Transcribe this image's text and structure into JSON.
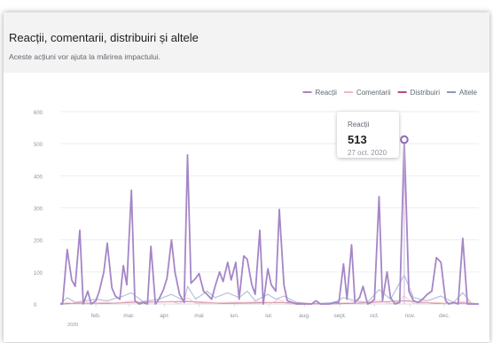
{
  "header": {
    "title": "Reacții, comentarii, distribuiri și altele",
    "subtitle": "Aceste acțiuni vor ajuta la mărirea impactului."
  },
  "tooltip": {
    "label": "Reacții",
    "value": "513",
    "date": "27 oct. 2020"
  },
  "chart_data": {
    "type": "line",
    "ylim": [
      0,
      600
    ],
    "y_ticks": [
      0,
      100,
      200,
      300,
      400,
      500,
      600
    ],
    "y_tick_labels": [
      "0",
      "100",
      "200",
      "300",
      "400",
      "500",
      "600"
    ],
    "x_range": [
      "2020-01-01",
      "2020-12-31"
    ],
    "x_ticks": [
      {
        "date": "2020-02-01",
        "label": "feb."
      },
      {
        "date": "2020-03-01",
        "label": "mar."
      },
      {
        "date": "2020-04-01",
        "label": "apr."
      },
      {
        "date": "2020-05-01",
        "label": "mai"
      },
      {
        "date": "2020-06-01",
        "label": "iun."
      },
      {
        "date": "2020-07-01",
        "label": "iul."
      },
      {
        "date": "2020-08-01",
        "label": "aug."
      },
      {
        "date": "2020-09-01",
        "label": "sept."
      },
      {
        "date": "2020-10-01",
        "label": "oct."
      },
      {
        "date": "2020-11-01",
        "label": "nov."
      },
      {
        "date": "2020-12-01",
        "label": "dec."
      }
    ],
    "x_year_label": "2020",
    "legend": "top-right",
    "grid": true,
    "highlight": {
      "series": "Reacții",
      "date": "2020-10-27",
      "value": 513
    },
    "series": [
      {
        "name": "Reacții",
        "color": "#a586c6",
        "points": [
          [
            "2020-01-01",
            0
          ],
          [
            "2020-01-03",
            0
          ],
          [
            "2020-01-07",
            170
          ],
          [
            "2020-01-11",
            75
          ],
          [
            "2020-01-14",
            55
          ],
          [
            "2020-01-18",
            230
          ],
          [
            "2020-01-21",
            0
          ],
          [
            "2020-01-25",
            40
          ],
          [
            "2020-01-28",
            0
          ],
          [
            "2020-02-01",
            10
          ],
          [
            "2020-02-04",
            40
          ],
          [
            "2020-02-08",
            100
          ],
          [
            "2020-02-11",
            190
          ],
          [
            "2020-02-15",
            50
          ],
          [
            "2020-02-18",
            25
          ],
          [
            "2020-02-22",
            15
          ],
          [
            "2020-02-25",
            120
          ],
          [
            "2020-02-28",
            60
          ],
          [
            "2020-03-03",
            355
          ],
          [
            "2020-03-06",
            10
          ],
          [
            "2020-03-10",
            0
          ],
          [
            "2020-03-13",
            5
          ],
          [
            "2020-03-17",
            0
          ],
          [
            "2020-03-20",
            180
          ],
          [
            "2020-03-24",
            0
          ],
          [
            "2020-03-27",
            15
          ],
          [
            "2020-03-31",
            45
          ],
          [
            "2020-04-03",
            80
          ],
          [
            "2020-04-07",
            200
          ],
          [
            "2020-04-10",
            100
          ],
          [
            "2020-04-14",
            30
          ],
          [
            "2020-04-18",
            5
          ],
          [
            "2020-04-21",
            465
          ],
          [
            "2020-04-24",
            65
          ],
          [
            "2020-04-28",
            80
          ],
          [
            "2020-05-01",
            95
          ],
          [
            "2020-05-05",
            40
          ],
          [
            "2020-05-08",
            30
          ],
          [
            "2020-05-12",
            15
          ],
          [
            "2020-05-15",
            55
          ],
          [
            "2020-05-19",
            100
          ],
          [
            "2020-05-22",
            70
          ],
          [
            "2020-05-26",
            130
          ],
          [
            "2020-05-29",
            75
          ],
          [
            "2020-06-02",
            130
          ],
          [
            "2020-06-05",
            15
          ],
          [
            "2020-06-09",
            150
          ],
          [
            "2020-06-12",
            140
          ],
          [
            "2020-06-16",
            60
          ],
          [
            "2020-06-19",
            30
          ],
          [
            "2020-06-23",
            230
          ],
          [
            "2020-06-26",
            0
          ],
          [
            "2020-06-30",
            110
          ],
          [
            "2020-07-03",
            60
          ],
          [
            "2020-07-07",
            40
          ],
          [
            "2020-07-10",
            295
          ],
          [
            "2020-07-14",
            60
          ],
          [
            "2020-07-17",
            10
          ],
          [
            "2020-07-21",
            5
          ],
          [
            "2020-07-25",
            0
          ],
          [
            "2020-07-29",
            0
          ],
          [
            "2020-08-01",
            0
          ],
          [
            "2020-08-07",
            0
          ],
          [
            "2020-08-11",
            10
          ],
          [
            "2020-08-15",
            0
          ],
          [
            "2020-08-19",
            0
          ],
          [
            "2020-08-23",
            0
          ],
          [
            "2020-08-27",
            5
          ],
          [
            "2020-08-31",
            5
          ],
          [
            "2020-09-04",
            125
          ],
          [
            "2020-09-07",
            15
          ],
          [
            "2020-09-11",
            185
          ],
          [
            "2020-09-14",
            5
          ],
          [
            "2020-09-18",
            20
          ],
          [
            "2020-09-21",
            55
          ],
          [
            "2020-09-25",
            0
          ],
          [
            "2020-09-28",
            5
          ],
          [
            "2020-10-01",
            15
          ],
          [
            "2020-10-05",
            335
          ],
          [
            "2020-10-08",
            10
          ],
          [
            "2020-10-12",
            100
          ],
          [
            "2020-10-15",
            20
          ],
          [
            "2020-10-19",
            0
          ],
          [
            "2020-10-23",
            5
          ],
          [
            "2020-10-27",
            513
          ],
          [
            "2020-10-31",
            40
          ],
          [
            "2020-11-04",
            10
          ],
          [
            "2020-11-08",
            5
          ],
          [
            "2020-11-12",
            15
          ],
          [
            "2020-11-16",
            30
          ],
          [
            "2020-11-20",
            40
          ],
          [
            "2020-11-24",
            145
          ],
          [
            "2020-11-28",
            130
          ],
          [
            "2020-12-02",
            10
          ],
          [
            "2020-12-05",
            0
          ],
          [
            "2020-12-09",
            5
          ],
          [
            "2020-12-13",
            0
          ],
          [
            "2020-12-17",
            205
          ],
          [
            "2020-12-21",
            0
          ],
          [
            "2020-12-25",
            0
          ],
          [
            "2020-12-31",
            0
          ]
        ]
      },
      {
        "name": "Comentarii",
        "color": "#f2b8bd",
        "points": [
          [
            "2020-01-01",
            0
          ],
          [
            "2020-01-07",
            5
          ],
          [
            "2020-01-11",
            2
          ],
          [
            "2020-01-18",
            8
          ],
          [
            "2020-01-25",
            0
          ],
          [
            "2020-02-11",
            6
          ],
          [
            "2020-02-18",
            1
          ],
          [
            "2020-03-03",
            10
          ],
          [
            "2020-03-10",
            0
          ],
          [
            "2020-03-20",
            5
          ],
          [
            "2020-04-07",
            8
          ],
          [
            "2020-04-14",
            0
          ],
          [
            "2020-04-21",
            20
          ],
          [
            "2020-04-28",
            2
          ],
          [
            "2020-05-19",
            4
          ],
          [
            "2020-06-02",
            6
          ],
          [
            "2020-06-09",
            5
          ],
          [
            "2020-06-23",
            8
          ],
          [
            "2020-07-03",
            3
          ],
          [
            "2020-07-10",
            15
          ],
          [
            "2020-07-17",
            0
          ],
          [
            "2020-08-15",
            0
          ],
          [
            "2020-09-04",
            4
          ],
          [
            "2020-09-11",
            6
          ],
          [
            "2020-09-18",
            0
          ],
          [
            "2020-10-05",
            12
          ],
          [
            "2020-10-12",
            3
          ],
          [
            "2020-10-19",
            0
          ],
          [
            "2020-10-27",
            25
          ],
          [
            "2020-11-04",
            2
          ],
          [
            "2020-11-24",
            5
          ],
          [
            "2020-12-05",
            0
          ],
          [
            "2020-12-17",
            8
          ],
          [
            "2020-12-31",
            0
          ]
        ]
      },
      {
        "name": "Distribuiri",
        "color": "#b24d7b",
        "points": [
          [
            "2020-01-01",
            0
          ],
          [
            "2020-01-18",
            3
          ],
          [
            "2020-02-11",
            2
          ],
          [
            "2020-03-03",
            5
          ],
          [
            "2020-04-21",
            8
          ],
          [
            "2020-05-22",
            2
          ],
          [
            "2020-06-23",
            4
          ],
          [
            "2020-07-10",
            5
          ],
          [
            "2020-08-15",
            0
          ],
          [
            "2020-09-11",
            2
          ],
          [
            "2020-10-05",
            6
          ],
          [
            "2020-10-27",
            10
          ],
          [
            "2020-11-24",
            2
          ],
          [
            "2020-12-17",
            3
          ],
          [
            "2020-12-31",
            0
          ]
        ]
      },
      {
        "name": "Altele",
        "color": "#8b96c8",
        "points": [
          [
            "2020-01-01",
            0
          ],
          [
            "2020-01-07",
            20
          ],
          [
            "2020-01-14",
            5
          ],
          [
            "2020-02-01",
            15
          ],
          [
            "2020-02-11",
            10
          ],
          [
            "2020-02-25",
            25
          ],
          [
            "2020-03-03",
            35
          ],
          [
            "2020-03-13",
            8
          ],
          [
            "2020-03-27",
            15
          ],
          [
            "2020-04-07",
            30
          ],
          [
            "2020-04-18",
            10
          ],
          [
            "2020-04-21",
            55
          ],
          [
            "2020-04-28",
            15
          ],
          [
            "2020-05-08",
            40
          ],
          [
            "2020-05-15",
            20
          ],
          [
            "2020-05-26",
            35
          ],
          [
            "2020-06-05",
            20
          ],
          [
            "2020-06-12",
            40
          ],
          [
            "2020-06-19",
            10
          ],
          [
            "2020-06-30",
            30
          ],
          [
            "2020-07-07",
            15
          ],
          [
            "2020-07-14",
            25
          ],
          [
            "2020-07-25",
            5
          ],
          [
            "2020-08-07",
            0
          ],
          [
            "2020-08-27",
            5
          ],
          [
            "2020-09-04",
            20
          ],
          [
            "2020-09-14",
            10
          ],
          [
            "2020-09-25",
            5
          ],
          [
            "2020-10-05",
            45
          ],
          [
            "2020-10-15",
            15
          ],
          [
            "2020-10-27",
            90
          ],
          [
            "2020-11-04",
            20
          ],
          [
            "2020-11-16",
            10
          ],
          [
            "2020-11-28",
            25
          ],
          [
            "2020-12-09",
            5
          ],
          [
            "2020-12-17",
            35
          ],
          [
            "2020-12-25",
            0
          ],
          [
            "2020-12-31",
            0
          ]
        ]
      }
    ]
  }
}
